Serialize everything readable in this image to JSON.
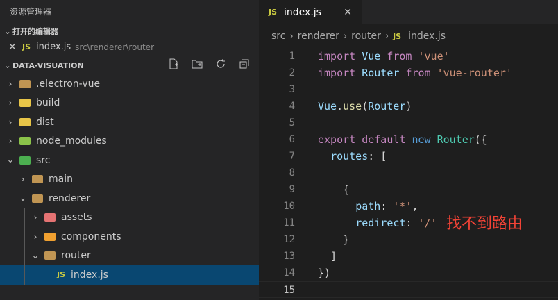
{
  "sidebar": {
    "title": "资源管理器",
    "open_editors": {
      "header": "打开的编辑器",
      "items": [
        {
          "name": "index.js",
          "path": "src\\renderer\\router",
          "badge": "JS"
        }
      ]
    },
    "explorer": {
      "header": "DATA-VISUATION",
      "tree": [
        {
          "label": ".electron-vue",
          "twistie": "›",
          "icon_color": "#c09553",
          "depth": 0
        },
        {
          "label": "build",
          "twistie": "›",
          "icon_color": "#e8c548",
          "depth": 0
        },
        {
          "label": "dist",
          "twistie": "›",
          "icon_color": "#e8c548",
          "depth": 0
        },
        {
          "label": "node_modules",
          "twistie": "›",
          "icon_color": "#8bc34a",
          "depth": 0
        },
        {
          "label": "src",
          "twistie": "⌄",
          "icon_color": "#4caf50",
          "depth": 0
        },
        {
          "label": "main",
          "twistie": "›",
          "icon_color": "#c09553",
          "depth": 1
        },
        {
          "label": "renderer",
          "twistie": "⌄",
          "icon_color": "#c09553",
          "depth": 1
        },
        {
          "label": "assets",
          "twistie": "›",
          "icon_color": "#e57373",
          "depth": 2
        },
        {
          "label": "components",
          "twistie": "›",
          "icon_color": "#f0a030",
          "depth": 2
        },
        {
          "label": "router",
          "twistie": "⌄",
          "icon_color": "#c09553",
          "depth": 2
        },
        {
          "label": "index.js",
          "twistie": "",
          "icon_color": "",
          "depth": 3,
          "is_file": true,
          "badge": "JS",
          "selected": true
        }
      ]
    }
  },
  "editor": {
    "tab": {
      "label": "index.js",
      "badge": "JS",
      "close": "✕"
    },
    "breadcrumb": [
      "src",
      "renderer",
      "router",
      "index.js"
    ],
    "breadcrumb_badge": "JS",
    "lines": [
      "1",
      "2",
      "3",
      "4",
      "5",
      "6",
      "7",
      "8",
      "9",
      "10",
      "11",
      "12",
      "13",
      "14",
      "15"
    ],
    "code": {
      "l1_import": "import",
      "l1_name": "Vue",
      "l1_from": "from",
      "l1_str": "'vue'",
      "l2_import": "import",
      "l2_name": "Router",
      "l2_from": "from",
      "l2_str": "'vue-router'",
      "l4_obj": "Vue",
      "l4_dot": ".",
      "l4_fn": "use",
      "l4_open": "(",
      "l4_arg": "Router",
      "l4_close": ")",
      "l6_export": "export",
      "l6_default": "default",
      "l6_new": "new",
      "l6_cls": "Router",
      "l6_rest": "({",
      "l7_prop": "routes",
      "l7_rest": ": [",
      "l9": "{",
      "l10_prop": "path",
      "l10_colon": ": ",
      "l10_str": "'*'",
      "l10_comma": ",",
      "l11_prop": "redirect",
      "l11_colon": ": ",
      "l11_str": "'/'",
      "l12": "}",
      "l13": "]",
      "l14": "})"
    },
    "annotation": "找不到路由"
  }
}
